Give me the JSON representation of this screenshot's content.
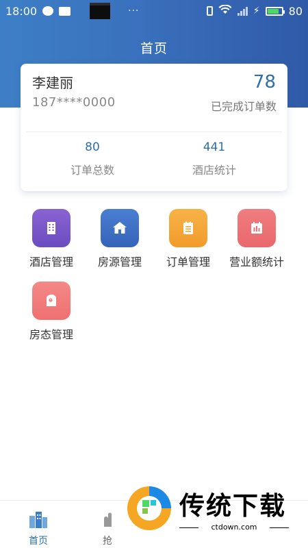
{
  "status_bar": {
    "time": "18:00",
    "dots": "···",
    "battery_level": "80"
  },
  "header": {
    "title": "首页"
  },
  "user_card": {
    "name": "李建丽",
    "phone": "187****0000",
    "completed_count": "78",
    "completed_label": "已完成订单数",
    "stats": [
      {
        "value": "80",
        "label": "订单总数"
      },
      {
        "value": "441",
        "label": "酒店统计"
      }
    ]
  },
  "menu": [
    {
      "label": "酒店管理",
      "icon": "hotel-icon",
      "color": "#7b57c9"
    },
    {
      "label": "房源管理",
      "icon": "house-icon",
      "color": "#3f70c2"
    },
    {
      "label": "订单管理",
      "icon": "order-list-icon",
      "color": "#f4a638"
    },
    {
      "label": "营业额统计",
      "icon": "calendar-chart-icon",
      "color": "#ec7275"
    },
    {
      "label": "房态管理",
      "icon": "room-status-icon",
      "color": "#f17b7b"
    }
  ],
  "tab_bar": {
    "items": [
      {
        "label": "首页",
        "icon": "buildings-icon",
        "active": true
      },
      {
        "label": "抢",
        "icon": "grab-icon",
        "active": false
      }
    ]
  },
  "watermark": {
    "text": "传统下载",
    "url": "ctdown.com"
  },
  "colors": {
    "header_gradient_start": "#3d7fc6",
    "header_gradient_end": "#2f5aa8",
    "accent_blue": "#2e6fa8"
  }
}
